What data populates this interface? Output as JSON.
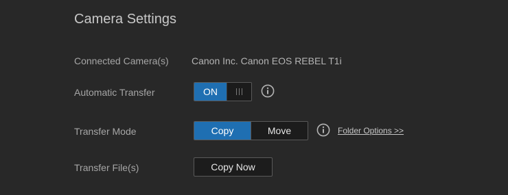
{
  "title": "Camera Settings",
  "connected_camera": {
    "label": "Connected Camera(s)",
    "value": "Canon Inc. Canon EOS REBEL T1i"
  },
  "automatic_transfer": {
    "label": "Automatic Transfer",
    "toggle_state_label": "ON",
    "enabled": true,
    "info_icon": "info-circle-icon"
  },
  "transfer_mode": {
    "label": "Transfer Mode",
    "options": [
      "Copy",
      "Move"
    ],
    "selected": "Copy",
    "info_icon": "info-circle-icon",
    "folder_options_link": "Folder Options >>"
  },
  "transfer_files": {
    "label": "Transfer File(s)",
    "button_label": "Copy Now"
  },
  "colors": {
    "background": "#282828",
    "accent": "#1f6fb2",
    "label_text": "#a6a6a6",
    "title_text": "#c8c8c8"
  }
}
